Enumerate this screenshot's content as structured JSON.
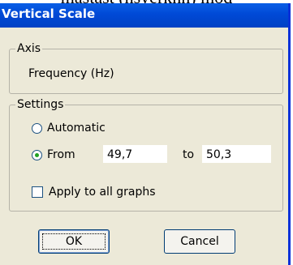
{
  "background": {
    "text": "mastast (hsyerknn) mod"
  },
  "window": {
    "title": "Vertical Scale",
    "axis_group": {
      "label": "Axis",
      "value": "Frequency (Hz)"
    },
    "settings_group": {
      "label": "Settings",
      "automatic_label": "Automatic",
      "from_label": "From",
      "to_label": "to",
      "from_value": "49,7",
      "to_value": "50,3",
      "selected": "from",
      "apply_label": "Apply to all graphs",
      "apply_checked": false
    },
    "buttons": {
      "ok": "OK",
      "cancel": "Cancel"
    }
  },
  "colors": {
    "titlebar": "#0a5fe6",
    "dialog_bg": "#ece9d8",
    "radio_dot": "#21a121"
  }
}
